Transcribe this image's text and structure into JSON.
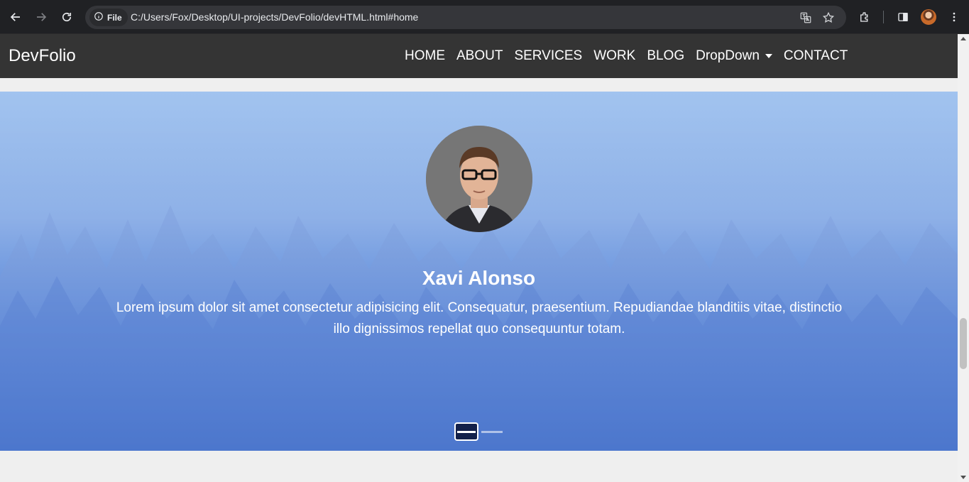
{
  "browser": {
    "site_chip_label": "File",
    "url": "C:/Users/Fox/Desktop/UI-projects/DevFolio/devHTML.html#home",
    "icons": [
      "back-icon",
      "forward-icon",
      "reload-icon",
      "info-icon",
      "translate-icon",
      "star-icon",
      "extensions-icon",
      "side-panel-icon",
      "profile-avatar",
      "more-menu-icon"
    ]
  },
  "navbar": {
    "brand": "DevFolio",
    "items": [
      {
        "label": "HOME"
      },
      {
        "label": "ABOUT"
      },
      {
        "label": "SERVICES"
      },
      {
        "label": "WORK"
      },
      {
        "label": "BLOG"
      },
      {
        "label": "DropDown"
      },
      {
        "label": "CONTACT"
      }
    ]
  },
  "hero": {
    "name": "Xavi Alonso",
    "text": "Lorem ipsum dolor sit amet consectetur adipisicing elit. Consequatur, praesentium. Repudiandae blanditiis vitae, distinctio illo dignissimos repellat quo consequuntur totam.",
    "slides": 2,
    "active_slide": 1
  },
  "colors": {
    "navbar_bg": "#343434",
    "chrome_bg": "#202124",
    "hero_top": "#8db6ec",
    "hero_bottom": "#2a5bc0"
  }
}
